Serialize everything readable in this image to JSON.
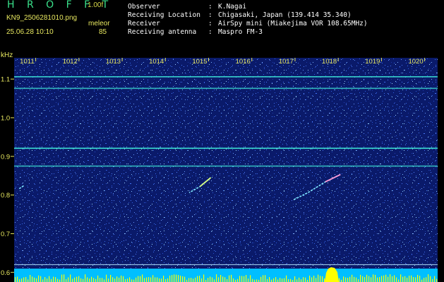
{
  "header": {
    "app_name": "H R O F F T",
    "version": "1.00f",
    "filename": "KN9_2506281010.png",
    "mode": "meleor",
    "datetime": "25.06.28 10:10",
    "count": "85"
  },
  "info": [
    {
      "key": "Observer",
      "sep": ":",
      "value": "K.Nagai"
    },
    {
      "key": "Receiving Location",
      "sep": ":",
      "value": "Chigasaki, Japan (139.414 35.340)"
    },
    {
      "key": "Receiver",
      "sep": ":",
      "value": "AirSpy mini (Miakejima VOR 108.65MHz)"
    },
    {
      "key": "Receiving antenna",
      "sep": ":",
      "value": "Maspro FM-3"
    }
  ],
  "y_axis_unit": "kHz",
  "colors": {
    "background": "#0a1a6a",
    "tick_labels": "#e8e860",
    "signal": "#3ee8d8",
    "bottom_bar": "#00bfff",
    "peak": "#ffff00"
  },
  "chart_data": {
    "type": "heatmap",
    "title": "",
    "xlabel": "",
    "ylabel": "kHz",
    "x_ticks": [
      "1011",
      "1012",
      "1013",
      "1014",
      "1015",
      "1016",
      "1017",
      "1018",
      "1019",
      "1020"
    ],
    "y_ticks": [
      "1.1",
      "1.0",
      "0.9",
      "0.8",
      "0.7",
      "0.6"
    ],
    "y_tick_values": [
      1.1,
      1.0,
      0.9,
      0.8,
      0.7,
      0.6
    ],
    "xlim": [
      1010.5,
      1020.3
    ],
    "ylim": [
      0.575,
      1.155
    ],
    "horizontal_lines_khz": [
      1.106,
      1.076,
      0.921,
      0.875,
      0.62
    ],
    "meteor_traces": [
      {
        "points": [
          [
            1015.05,
            0.845
          ],
          [
            1014.8,
            0.822
          ],
          [
            1014.55,
            0.806
          ]
        ]
      },
      {
        "points": [
          [
            1018.05,
            0.853
          ],
          [
            1017.7,
            0.834
          ],
          [
            1017.3,
            0.806
          ],
          [
            1016.95,
            0.787
          ]
        ]
      },
      {
        "points": [
          [
            1010.72,
            0.824
          ],
          [
            1010.6,
            0.815
          ]
        ]
      }
    ],
    "grid": false
  }
}
